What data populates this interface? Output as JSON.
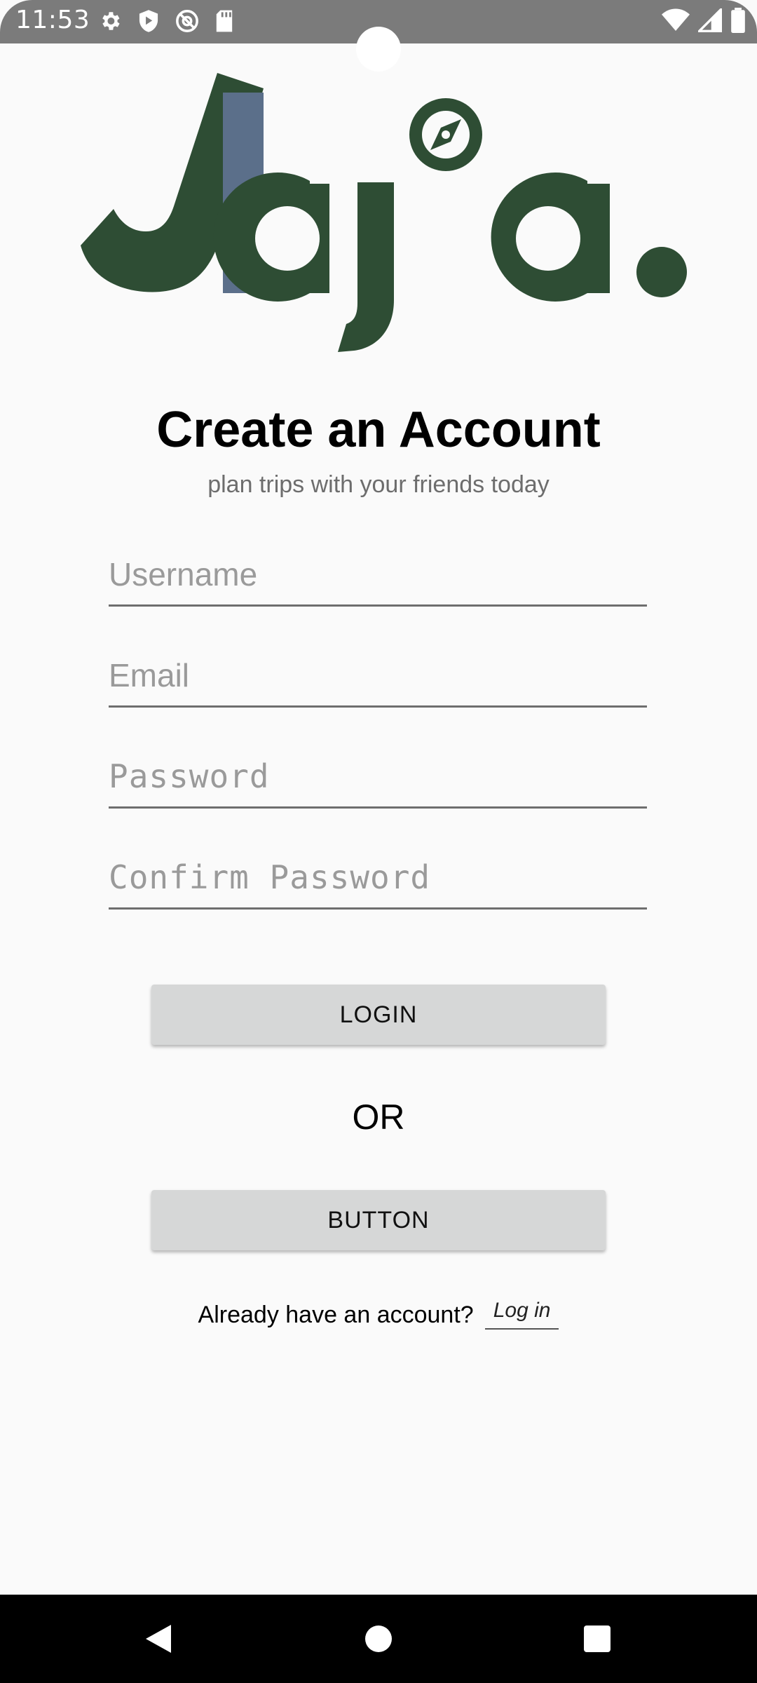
{
  "status_bar": {
    "time": "11:53",
    "icons_left": [
      "settings-icon",
      "play-protect-icon",
      "no-disturb-icon",
      "sd-card-icon"
    ],
    "icons_right": [
      "wifi-icon",
      "signal-icon",
      "battery-icon"
    ]
  },
  "logo": {
    "alt": "Jaja.",
    "colors": {
      "primary": "#2e4d34",
      "accent": "#5b6f8a"
    }
  },
  "header": {
    "title": "Create an Account",
    "subtitle": "plan trips with your friends today"
  },
  "form": {
    "username_placeholder": "Username",
    "email_placeholder": "Email",
    "password_placeholder": "Password",
    "confirm_password_placeholder": "Confirm Password"
  },
  "actions": {
    "login_label": "LOGIN",
    "or_label": "OR",
    "button_label": "BUTTON"
  },
  "footer": {
    "already_text": "Already have an account?",
    "login_link": "Log in"
  },
  "nav_bar": {
    "icons": [
      "back-icon",
      "home-icon",
      "recents-icon"
    ]
  }
}
